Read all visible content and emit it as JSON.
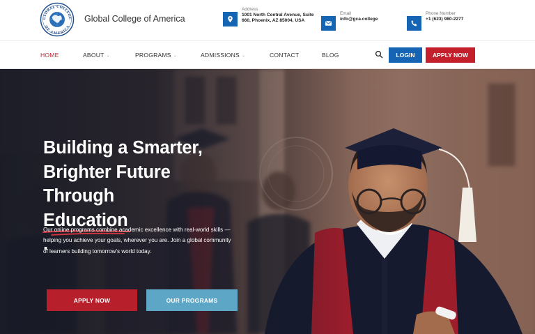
{
  "brand": {
    "name": "Global College of America",
    "seal_text": "GLOBAL COLLEGE OF AMERICA"
  },
  "contact": {
    "address": {
      "label": "Address",
      "value": "1001 North Central Avenue, Suite 660, Phoenix, AZ 85004, USA",
      "icon": "map-pin-icon"
    },
    "email": {
      "label": "Email",
      "value": "info@gca.college",
      "icon": "envelope-icon"
    },
    "phone": {
      "label": "Phone Number",
      "value": "+1 (623) 980-2277",
      "icon": "phone-icon"
    }
  },
  "nav": {
    "items": [
      {
        "label": "HOME",
        "active": true
      },
      {
        "label": "ABOUT",
        "dropdown": true
      },
      {
        "label": "PROGRAMS",
        "dropdown": true
      },
      {
        "label": "ADMISSIONS",
        "dropdown": true
      },
      {
        "label": "CONTACT"
      },
      {
        "label": "BLOG"
      }
    ],
    "search_icon": "search-icon",
    "login_label": "LOGIN",
    "apply_label": "APPLY NOW"
  },
  "hero": {
    "headline_line1": "Building a Smarter,",
    "headline_line2": "Brighter Future",
    "headline_line3_prefix": "Through ",
    "headline_line3_highlight": "Education",
    "headline_line3_suffix": ".",
    "description": "Our online programs combine academic excellence with real-world skills — helping you achieve your goals, wherever you are. Join a global community of learners building tomorrow’s world today.",
    "apply_label": "APPLY NOW",
    "programs_label": "OUR PROGRAMS"
  },
  "colors": {
    "primary_blue": "#1565b4",
    "accent_red": "#c4202c",
    "programs_button": "#5da6c6",
    "nav_active": "#c4252f"
  }
}
